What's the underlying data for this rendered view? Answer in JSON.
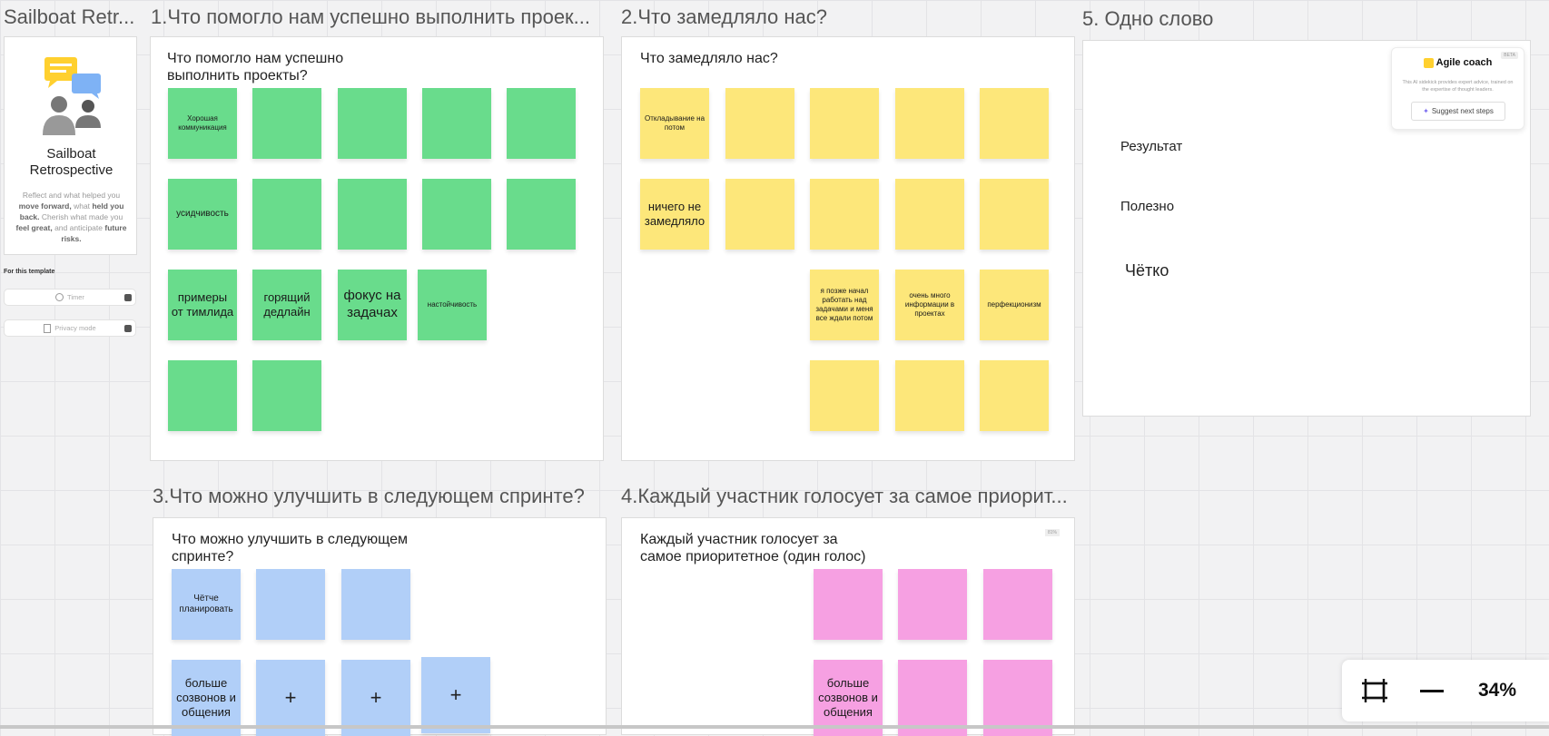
{
  "frame_titles": {
    "template": "Sailboat Retr...",
    "f1": "1.Что помогло нам успешно выполнить проек...",
    "f2": "2.Что замедляло нас?",
    "f3": "3.Что можно улучшить в следующем спринте?",
    "f4": "4.Каждый участник голосует за самое приорит...",
    "f5": "5. Одно слово"
  },
  "template_card": {
    "name_line1": "Sailboat",
    "name_line2": "Retrospective",
    "desc": {
      "a": "Reflect and what helped you",
      "b": "move forward,",
      "c": "what",
      "d": "held you back.",
      "e": "Cherish what made you",
      "f": "feel great,",
      "g": "and anticipate",
      "h": "future risks."
    },
    "for_this_template": "For this template",
    "timer_label": "Timer",
    "privacy_label": "Privacy mode"
  },
  "frame1": {
    "heading_line1": "Что помогло нам успешно",
    "heading_line2": "выполнить проекты?",
    "notes": [
      "Хорошая коммуникация",
      "",
      "",
      "",
      "",
      "усидчивость",
      "",
      "",
      "",
      "",
      "примеры от тимлида",
      "горящий дедлайн",
      "фокус на задачах",
      "настойчивость",
      "",
      ""
    ]
  },
  "frame2": {
    "heading": "Что замедляло нас?",
    "notes": [
      "Откладывание на потом",
      "",
      "",
      "",
      "",
      "ничего не замедляло",
      "",
      "",
      "",
      "",
      "я позже начал работать над задачами и меня все ждали потом",
      "очень много информации в проектах",
      "перфекционизм",
      "",
      "",
      ""
    ]
  },
  "frame3": {
    "heading_line1": "Что можно улучшить в следующем",
    "heading_line2": "спринте?",
    "notes": [
      "Чётче планировать",
      "",
      "",
      "больше созвонов и общения",
      "+",
      "+",
      "+"
    ]
  },
  "frame4": {
    "heading_line1": "Каждый участник голосует за",
    "heading_line2": "самое приоритетное (один голос)",
    "badge": "81%",
    "notes": [
      "",
      "",
      "",
      "больше созвонов и общения",
      "",
      ""
    ]
  },
  "frame5": {
    "words": [
      "Результат",
      "Полезно",
      "Чётко"
    ]
  },
  "agile_coach": {
    "badge": "BETA",
    "title": "Agile coach",
    "desc": "This AI sidekick provides expert advice, trained on the expertise of thought leaders.",
    "button": "Suggest next steps"
  },
  "zoom": {
    "level": "34%"
  },
  "colors": {
    "green_note": "#69dc8c",
    "yellow_note": "#fde77a",
    "blue_note": "#b1cff8",
    "pink_note": "#f6a0e2",
    "canvas": "#f2f2f3"
  }
}
